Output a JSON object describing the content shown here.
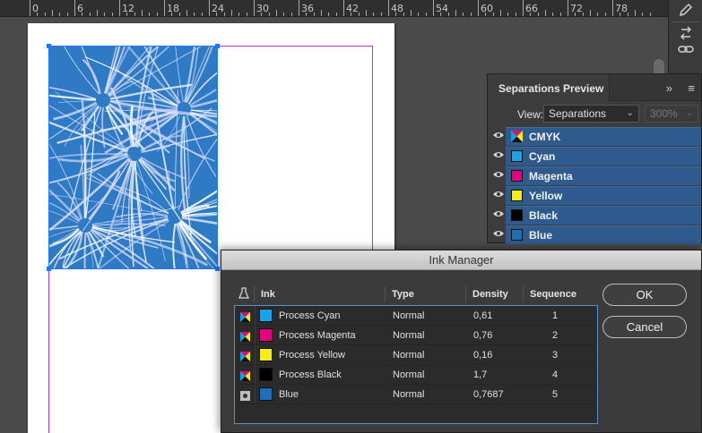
{
  "ruler": {
    "labels": [
      "0",
      "6",
      "12",
      "18",
      "24",
      "30",
      "36",
      "42",
      "48",
      "54",
      "60",
      "66",
      "72",
      "78"
    ]
  },
  "tools": {
    "icons": [
      "pen-icon",
      "swap-icon",
      "link-icon"
    ]
  },
  "separations_panel": {
    "title": "Separations Preview",
    "view_label": "View:",
    "view_value": "Separations",
    "zoom_value": "300%",
    "rows": [
      {
        "name": "CMYK",
        "color": "cmyk"
      },
      {
        "name": "Cyan",
        "color": "#1aa3e8"
      },
      {
        "name": "Magenta",
        "color": "#e6007e"
      },
      {
        "name": "Yellow",
        "color": "#f7ec13"
      },
      {
        "name": "Black",
        "color": "#000000"
      },
      {
        "name": "Blue",
        "color": "#1c6fb8"
      }
    ]
  },
  "ink_manager": {
    "title": "Ink Manager",
    "columns": {
      "ink": "Ink",
      "type": "Type",
      "density": "Density",
      "sequence": "Sequence"
    },
    "rows": [
      {
        "ink": "Process Cyan",
        "type": "Normal",
        "density": "0,61",
        "sequence": "1",
        "color": "#1aa3e8",
        "kind": "process"
      },
      {
        "ink": "Process Magenta",
        "type": "Normal",
        "density": "0,76",
        "sequence": "2",
        "color": "#e6007e",
        "kind": "process"
      },
      {
        "ink": "Process Yellow",
        "type": "Normal",
        "density": "0,16",
        "sequence": "3",
        "color": "#f7ec13",
        "kind": "process"
      },
      {
        "ink": "Process Black",
        "type": "Normal",
        "density": "1,7",
        "sequence": "4",
        "color": "#000000",
        "kind": "process"
      },
      {
        "ink": "Blue",
        "type": "Normal",
        "density": "0,7687",
        "sequence": "5",
        "color": "#1c6fb8",
        "kind": "spot"
      }
    ],
    "ok_label": "OK",
    "cancel_label": "Cancel"
  },
  "colors": {
    "accent": "#1e78ff",
    "margin_guide": "#c432c4",
    "selection_row": "#2f5a8d"
  }
}
